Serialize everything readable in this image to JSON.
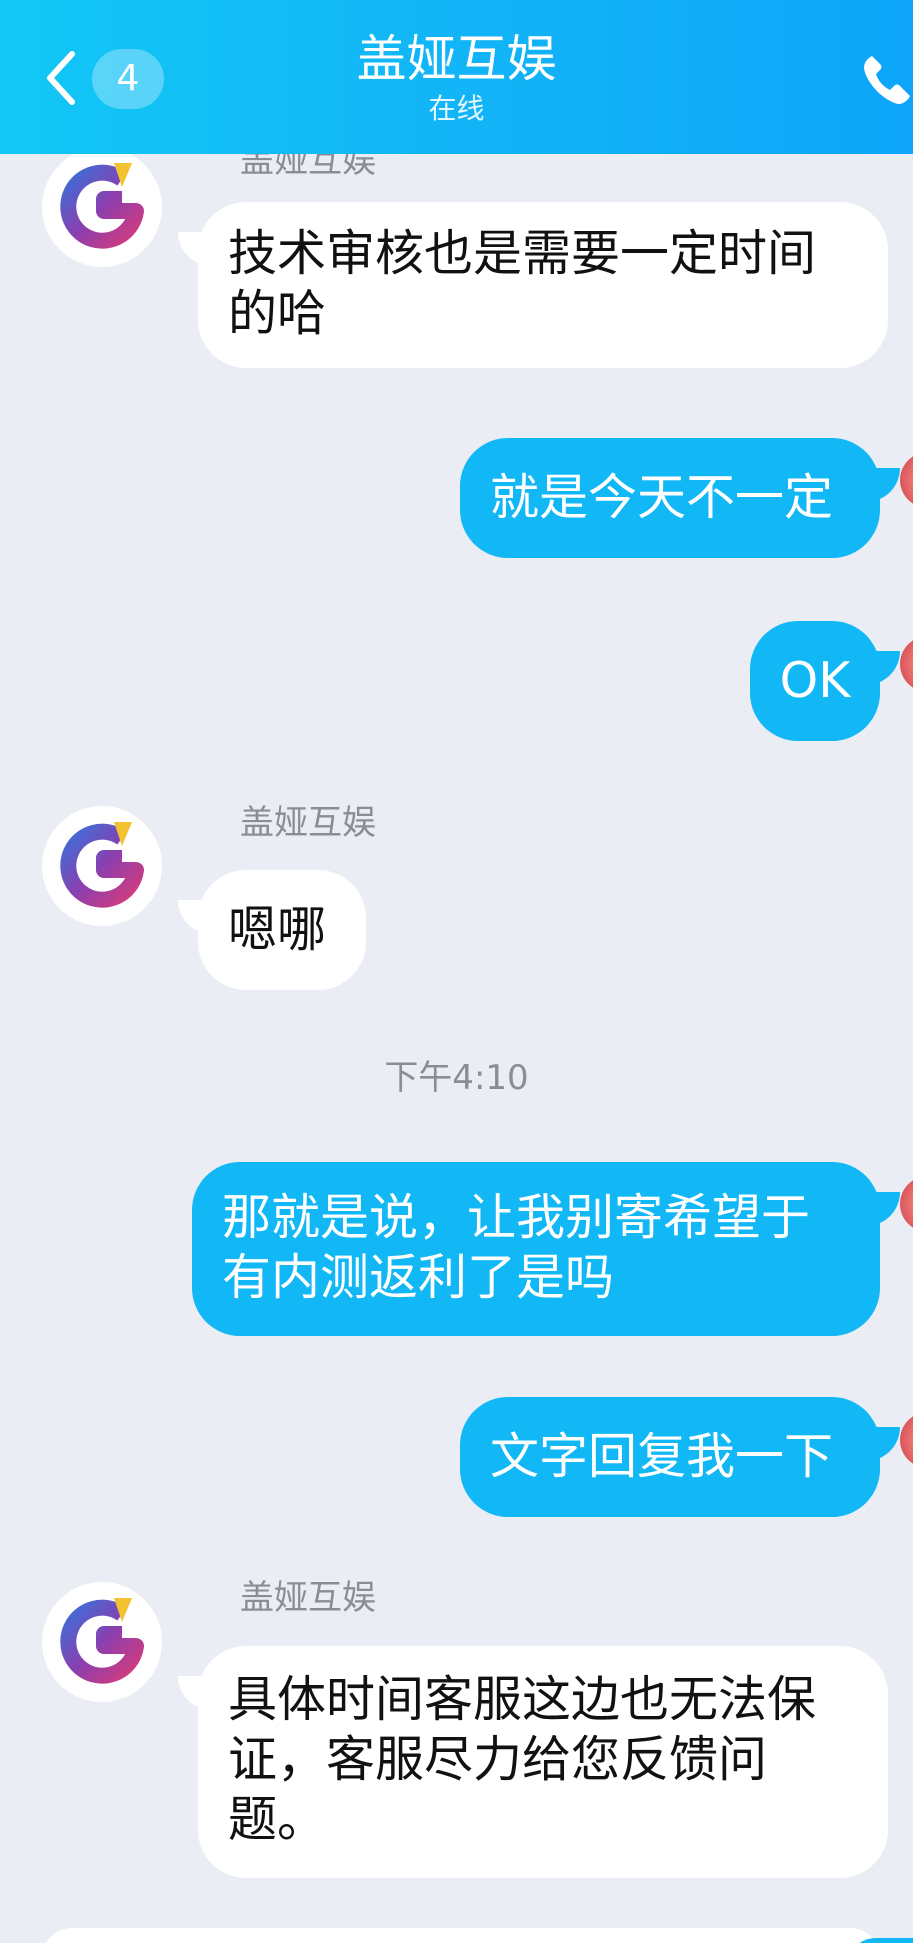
{
  "header": {
    "back_count": "4",
    "title": "盖娅互娱",
    "status": "在线"
  },
  "colors": {
    "header": "#12b7f5",
    "outgoing_bubble": "#12b7f5",
    "incoming_bubble": "#ffffff",
    "background": "#ebedf5"
  },
  "messages": [
    {
      "direction": "in",
      "sender": "盖娅互娱",
      "lines": [
        "技术审核也是需要一定时间",
        "的哈"
      ]
    },
    {
      "direction": "out",
      "lines": [
        "就是今天不一定"
      ]
    },
    {
      "direction": "out",
      "lines": [
        "OK"
      ]
    },
    {
      "direction": "in",
      "sender": "盖娅互娱",
      "lines": [
        "嗯哪"
      ]
    },
    {
      "type": "time",
      "text": "下午4:10"
    },
    {
      "direction": "out",
      "lines": [
        "那就是说，让我别寄希望于",
        "有内测返利了是吗"
      ]
    },
    {
      "direction": "out",
      "lines": [
        "文字回复我一下"
      ]
    },
    {
      "direction": "in",
      "sender": "盖娅互娱",
      "lines": [
        "具体时间客服这边也无法保",
        "证，客服尽力给您反馈问",
        "题。"
      ]
    }
  ]
}
